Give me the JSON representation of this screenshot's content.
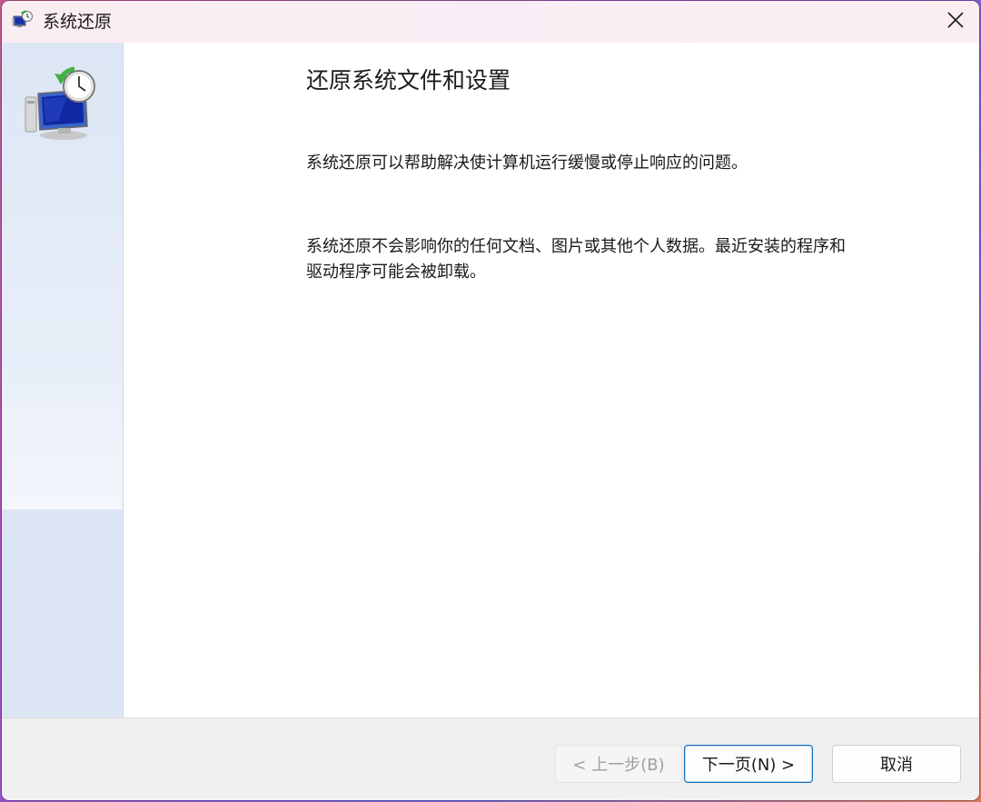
{
  "window": {
    "title": "系统还原",
    "close_glyph": "✕"
  },
  "icons": {
    "title": "system-restore-icon",
    "sidebar": "system-restore-large-icon",
    "close": "close-icon"
  },
  "main": {
    "heading": "还原系统文件和设置",
    "paragraph1": "系统还原可以帮助解决使计算机运行缓慢或停止响应的问题。",
    "paragraph2_line1": "系统还原不会影响你的任何文档、图片或其他个人数据。最近安装的程序和",
    "paragraph2_line2": "驱动程序可能会被卸载。"
  },
  "footer": {
    "back_label": "< 上一步(B)",
    "next_label": "下一页(N) >",
    "cancel_label": "取消"
  },
  "colors": {
    "accent": "#0f6cbd",
    "sidebar": "#dce6f4",
    "footer": "#f0f0f0"
  }
}
